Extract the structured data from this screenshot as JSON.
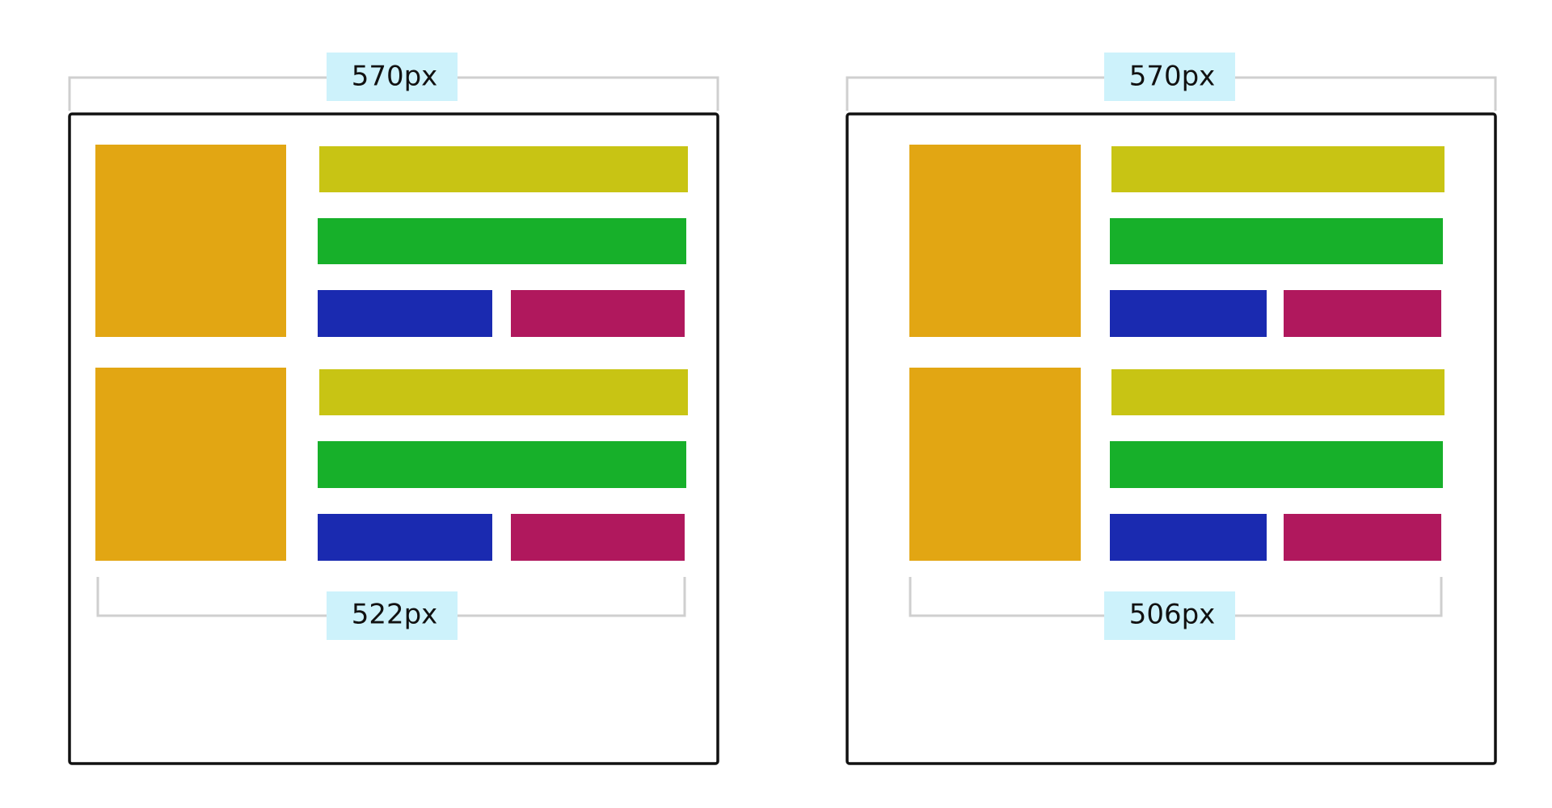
{
  "colors": {
    "image_block": "#e2a613",
    "bar_yellow": "#c8c414",
    "bar_green": "#17b02a",
    "bar_blue": "#1a2ab0",
    "bar_magenta": "#b0185d",
    "label_background": "#cdf2fb",
    "bracket": "#cfcfcf",
    "frame_border": "#111111"
  },
  "panels": [
    {
      "outer_width_label": "570px",
      "inner_width_label": "522px"
    },
    {
      "outer_width_label": "570px",
      "inner_width_label": "506px"
    }
  ]
}
